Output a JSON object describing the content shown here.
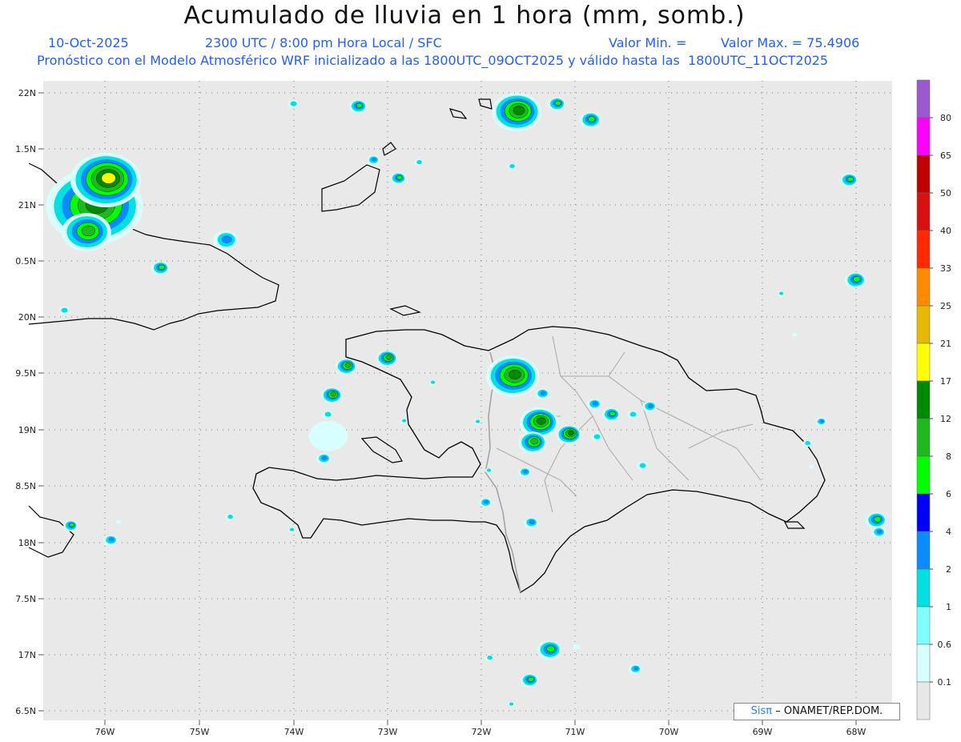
{
  "header": {
    "title": "Acumulado de lluvia en 1 hora (mm, somb.)",
    "date": "10-Oct-2025",
    "time": "2300 UTC / 8:00 pm Hora Local / SFC",
    "val_min": "Valor Min. =",
    "val_max": "Valor Max. = 75.4906",
    "forecast": "Pronóstico con el Modelo Atmosférico WRF inicializado a las 1800UTC_09OCT2025 y válido hasta las  1800UTC_11OCT2025"
  },
  "axes": {
    "lat_labels": [
      "22N",
      "1.5N",
      "21N",
      "0.5N",
      "20N",
      "9.5N",
      "19N",
      "8.5N",
      "18N",
      "7.5N",
      "17N",
      "6.5N"
    ],
    "lon_labels": [
      "76W",
      "75W",
      "74W",
      "73W",
      "72W",
      "71W",
      "70W",
      "69W",
      "68W"
    ]
  },
  "colorbar": {
    "labels": [
      "80",
      "65",
      "50",
      "40",
      "33",
      "25",
      "21",
      "17",
      "12",
      "8",
      "6",
      "4",
      "2",
      "1",
      "0.6",
      "0.1"
    ],
    "colors": [
      "#9b59d0",
      "#ff00ff",
      "#c00000",
      "#d81010",
      "#ff2a00",
      "#ff8c00",
      "#e6b800",
      "#ffff00",
      "#008a00",
      "#1fb81f",
      "#00ff00",
      "#0000ff",
      "#0a8cff",
      "#00e0e0",
      "#80ffff",
      "#d8ffff",
      "#e8e8e8"
    ]
  },
  "credit": {
    "brand": "Sisπ",
    "text": "– ONAMET/REP.DOM."
  },
  "colors": {
    "background": "#e9e9e9",
    "coast": "#000000",
    "borders": "#a0a0a0",
    "text_blue": "#1f5fff"
  }
}
